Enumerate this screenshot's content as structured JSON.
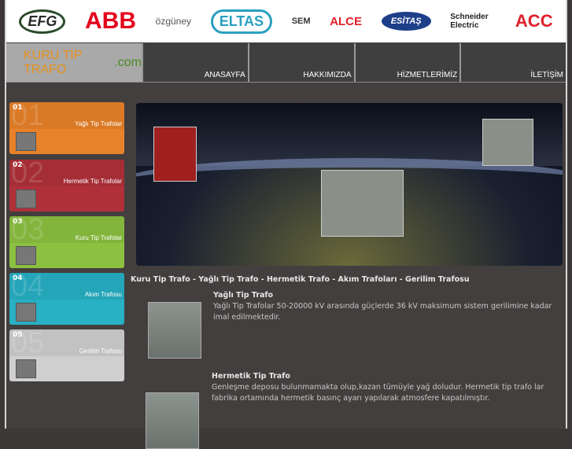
{
  "logos": [
    "EFG",
    "ABB",
    "özgüney",
    "ELTAS",
    "SEM",
    "ALCE",
    "ESİTAŞ",
    "Schneider Electric",
    "ACC"
  ],
  "brand": {
    "main": "KURU TİP TRAFO",
    "suffix": ".com"
  },
  "nav": [
    "ANASAYFA",
    "HAKKIMIZDA",
    "HİZMETLERİMİZ",
    "İLETİŞİM"
  ],
  "cards": [
    {
      "num": "01",
      "label": "Yağlı Tip Trafolar",
      "color": "#e8822a"
    },
    {
      "num": "02",
      "label": "Hermetik Tip Trafolar",
      "color": "#b0303a"
    },
    {
      "num": "03",
      "label": "Kuru Tip Trafolar",
      "color": "#8cc040"
    },
    {
      "num": "04",
      "label": "Akım Trafosu",
      "color": "#28b0c4"
    },
    {
      "num": "05",
      "label": "Gerilim Trafosu",
      "color": "#cfcfcf"
    }
  ],
  "headline": "Kuru Tip Trafo - Yağlı Tip Trafo - Hermetik Trafo - Akım Trafoları - Gerilim Trafosu",
  "items": [
    {
      "title": "Yağlı Tip Trafo",
      "desc": "Yağlı Tip Trafolar 50-20000 kV arasında güçlerde 36 kV maksimum sistem gerilimine kadar imal edilmektedir."
    },
    {
      "title": "Hermetik Tip Trafo",
      "desc": "Genleşme deposu bulunmamakta olup,kazan tümüyle yağ doludur. Hermetik tip trafo lar fabrika ortamında hermetik basınç ayarı yapılarak atmosfere kapatılmıştır."
    }
  ]
}
